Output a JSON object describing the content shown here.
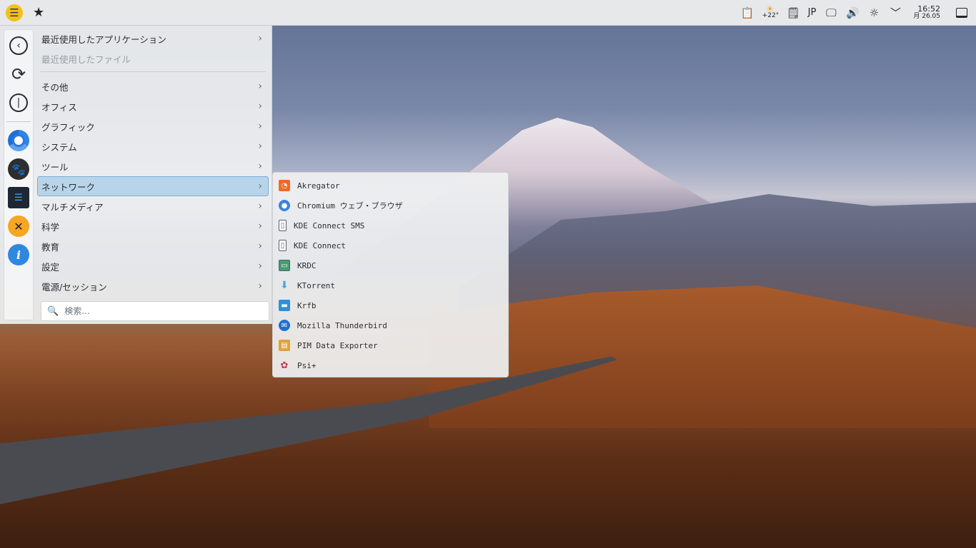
{
  "panel": {
    "launcher_icon": "menu-icon",
    "favorites_icon": "star-icon",
    "weather_temp": "+22°",
    "keyboard_layout": "JP",
    "clock_time": "16:52",
    "clock_date": "月 26.05"
  },
  "menu": {
    "items": [
      {
        "label": "最近使用したアプリケーション",
        "disabled": false
      },
      {
        "label": "最近使用したファイル",
        "disabled": true
      },
      {
        "label": "その他"
      },
      {
        "label": "オフィス"
      },
      {
        "label": "グラフィック"
      },
      {
        "label": "システム"
      },
      {
        "label": "ツール"
      },
      {
        "label": "ネットワーク",
        "selected": true
      },
      {
        "label": "マルチメディア"
      },
      {
        "label": "科学"
      },
      {
        "label": "教育"
      },
      {
        "label": "設定"
      },
      {
        "label": "電源/セッション"
      }
    ],
    "search_placeholder": "検索..."
  },
  "submenu": {
    "items": [
      {
        "label": "Akregator",
        "icon": "rss-icon",
        "color": "#f06a23"
      },
      {
        "label": "Chromium ウェブ・ブラウザ",
        "icon": "chromium-icon",
        "color": "#3b82e0"
      },
      {
        "label": "KDE Connect SMS",
        "icon": "phone-icon",
        "color": "#5a5f66"
      },
      {
        "label": "KDE Connect",
        "icon": "phone-icon",
        "color": "#5a5f66"
      },
      {
        "label": "KRDC",
        "icon": "remote-desktop-icon",
        "color": "#4b9a6b"
      },
      {
        "label": "KTorrent",
        "icon": "download-icon",
        "color": "#4ba3e3"
      },
      {
        "label": "Krfb",
        "icon": "desktop-share-icon",
        "color": "#2f8fd8"
      },
      {
        "label": "Mozilla Thunderbird",
        "icon": "thunderbird-icon",
        "color": "#1f6fd1"
      },
      {
        "label": "PIM Data Exporter",
        "icon": "exporter-icon",
        "color": "#e0a23a"
      },
      {
        "label": "Psi+",
        "icon": "psi-icon",
        "color": "#c9364f"
      }
    ]
  }
}
